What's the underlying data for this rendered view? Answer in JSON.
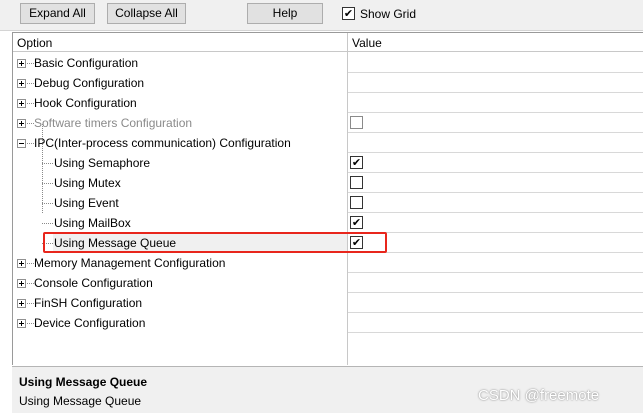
{
  "toolbar": {
    "expand_all_label": "Expand All",
    "collapse_all_label": "Collapse All",
    "help_label": "Help",
    "show_grid_label": "Show Grid",
    "show_grid_checked": true
  },
  "grid": {
    "columns": {
      "option": "Option",
      "value": "Value"
    },
    "rows": [
      {
        "label": "Basic Configuration",
        "level": 1,
        "expander": true,
        "checkbox": null
      },
      {
        "label": "Debug Configuration",
        "level": 1,
        "expander": true,
        "checkbox": null
      },
      {
        "label": "Hook Configuration",
        "level": 1,
        "expander": true,
        "checkbox": null
      },
      {
        "label": "Software timers Configuration",
        "level": 1,
        "expander": true,
        "disabled": true,
        "checkbox": "unchecked"
      },
      {
        "label": "IPC(Inter-process communication) Configuration",
        "level": 1,
        "expander": true,
        "expanded": true,
        "checkbox": null
      },
      {
        "label": "Using Semaphore",
        "level": 2,
        "checkbox": "checked"
      },
      {
        "label": "Using Mutex",
        "level": 2,
        "checkbox": "unchecked"
      },
      {
        "label": "Using Event",
        "level": 2,
        "checkbox": "unchecked"
      },
      {
        "label": "Using MailBox",
        "level": 2,
        "checkbox": "checked"
      },
      {
        "label": "Using Message Queue",
        "level": 2,
        "checkbox": "checked",
        "selected": true
      },
      {
        "label": "Memory Management Configuration",
        "level": 1,
        "expander": true,
        "checkbox": null
      },
      {
        "label": "Console Configuration",
        "level": 1,
        "expander": true,
        "checkbox": null
      },
      {
        "label": "FinSH Configuration",
        "level": 1,
        "expander": true,
        "checkbox": null
      },
      {
        "label": "Device Configuration",
        "level": 1,
        "expander": true,
        "checkbox": null
      }
    ]
  },
  "description": {
    "title": "Using Message Queue",
    "text": "Using Message Queue"
  },
  "watermark": "CSDN @freemote",
  "colors": {
    "highlight_box": "#e8261c",
    "disabled_text": "#8a8a8a",
    "panel_background": "#f0f0f0"
  },
  "icons": {
    "expander": "plus-box-icon",
    "checkmark": "check-icon"
  }
}
